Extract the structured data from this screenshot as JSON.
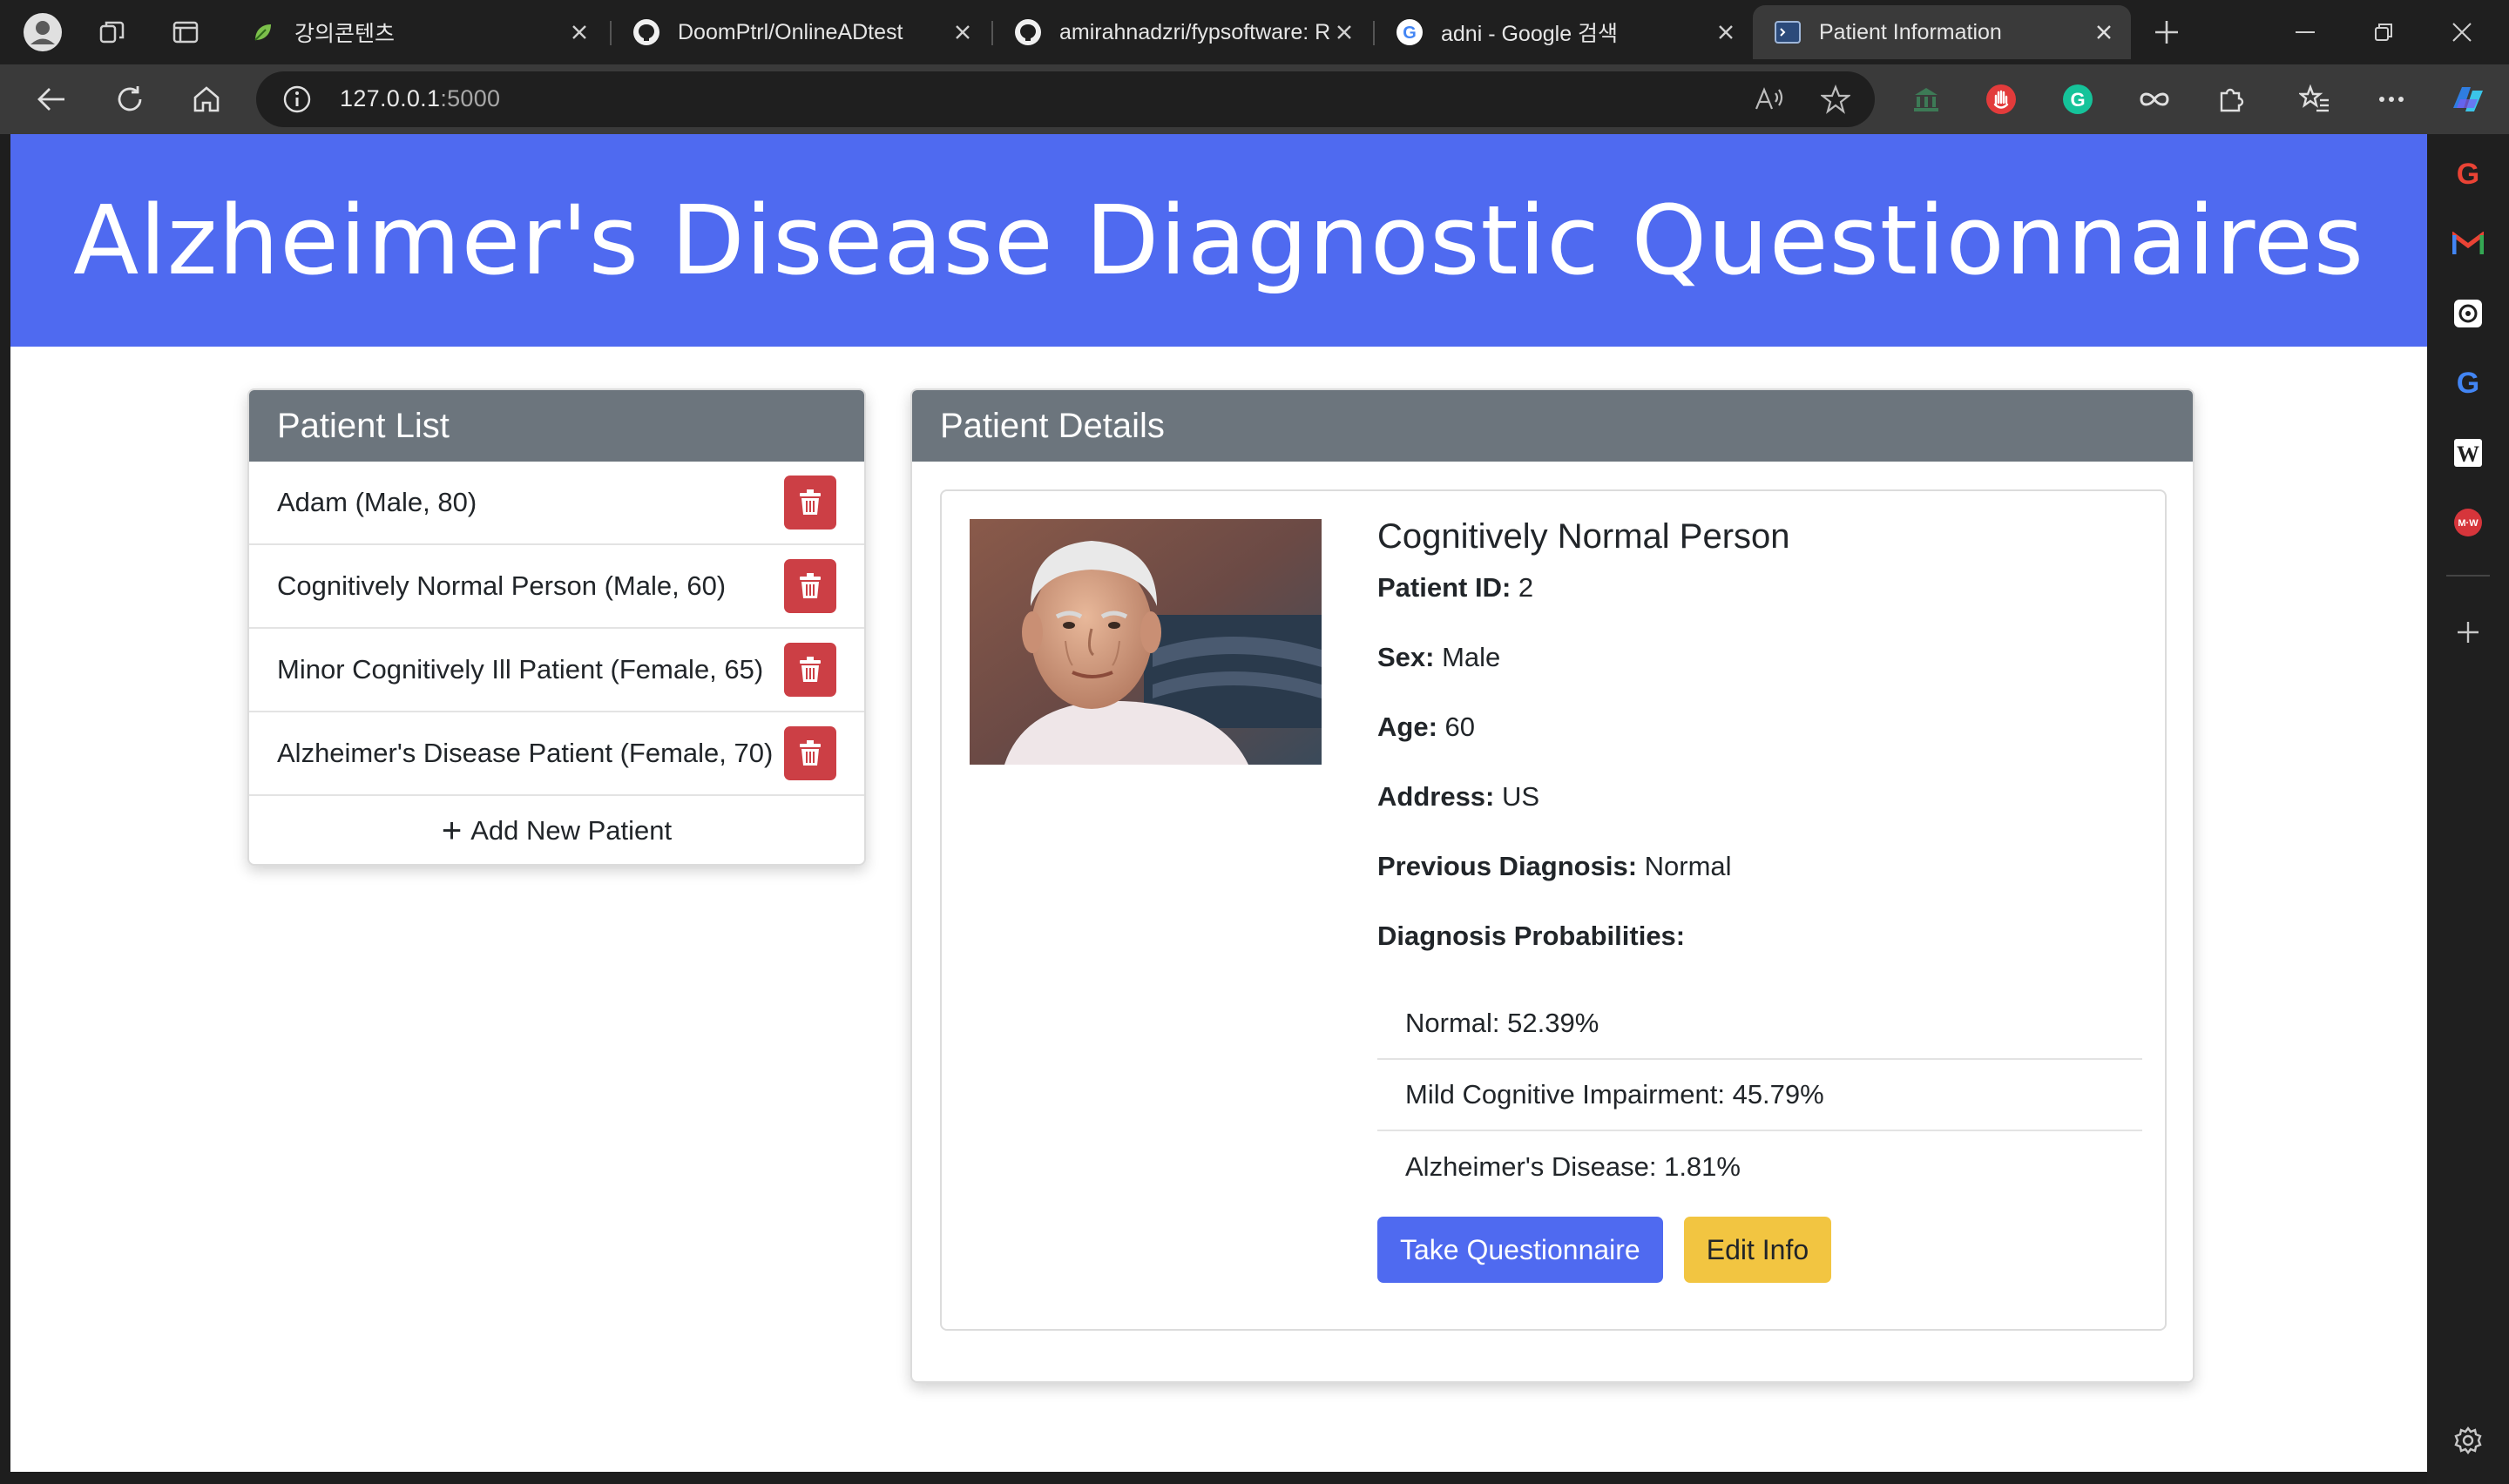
{
  "browser": {
    "tabs": [
      {
        "title": "강의콘텐츠",
        "icon": "leaf-icon"
      },
      {
        "title": "DoomPtrl/OnlineADtest",
        "icon": "github-icon"
      },
      {
        "title": "amirahnadzri/fypsoftware: Re",
        "icon": "github-icon"
      },
      {
        "title": "adni - Google 검색",
        "icon": "google-icon"
      },
      {
        "title": "Patient Information",
        "icon": "terminal-icon",
        "active": true
      }
    ],
    "address": {
      "host": "127.0.0.1",
      "port": ":5000"
    }
  },
  "page": {
    "banner_title": "Alzheimer's Disease Diagnostic Questionnaires",
    "patient_list": {
      "header": "Patient List",
      "patients": [
        "Adam (Male, 80)",
        "Cognitively Normal Person (Male, 60)",
        "Minor Cognitively Ill Patient (Female, 65)",
        "Alzheimer's Disease Patient (Female, 70)"
      ],
      "add_label": "Add New Patient"
    },
    "details": {
      "header": "Patient Details",
      "name": "Cognitively Normal Person",
      "fields": [
        {
          "label": "Patient ID:",
          "value": "2"
        },
        {
          "label": "Sex:",
          "value": "Male"
        },
        {
          "label": "Age:",
          "value": "60"
        },
        {
          "label": "Address:",
          "value": "US"
        },
        {
          "label": "Previous Diagnosis:",
          "value": "Normal"
        }
      ],
      "prob_label": "Diagnosis Probabilities:",
      "probabilities": [
        "Normal: 52.39%",
        "Mild Cognitive Impairment: 45.79%",
        "Alzheimer's Disease: 1.81%"
      ],
      "take_button": "Take Questionnaire",
      "edit_button": "Edit Info"
    }
  },
  "colors": {
    "banner": "#4f6af0",
    "card_header": "#6c757d",
    "delete_button": "#cc3f45",
    "primary_button": "#4f6af0",
    "warning_button": "#f2c541"
  }
}
